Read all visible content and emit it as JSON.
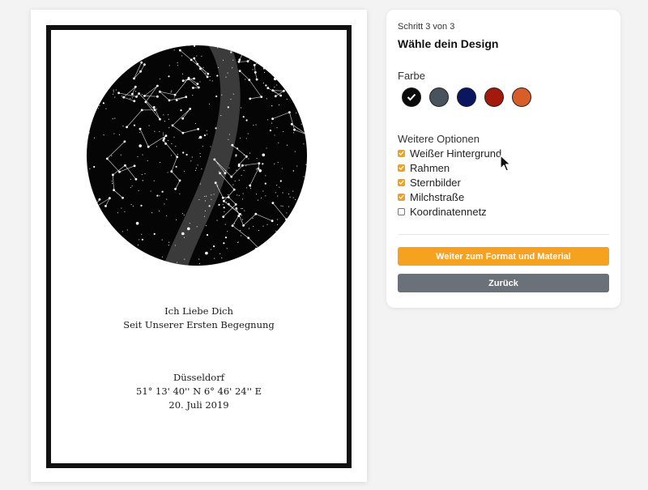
{
  "poster": {
    "message_line1": "Ich Liebe Dich",
    "message_line2": "Seit Unserer Ersten Begegnung",
    "location": "Düsseldorf",
    "coordinates": "51° 13' 40'' N 6° 46' 24'' E",
    "date": "20. Juli 2019"
  },
  "panel": {
    "step": "Schritt 3 von 3",
    "title": "Wähle dein Design",
    "color_label": "Farbe",
    "colors": [
      {
        "name": "black",
        "hex": "#0b0b0b",
        "selected": true
      },
      {
        "name": "slate",
        "hex": "#48535d",
        "selected": false
      },
      {
        "name": "navy",
        "hex": "#0b1660",
        "selected": false
      },
      {
        "name": "red",
        "hex": "#a31a0c",
        "selected": false
      },
      {
        "name": "orange",
        "hex": "#d95d2a",
        "selected": false
      }
    ],
    "options_label": "Weitere Optionen",
    "options": [
      {
        "label": "Weißer Hintergrund",
        "checked": true
      },
      {
        "label": "Rahmen",
        "checked": true
      },
      {
        "label": "Sternbilder",
        "checked": true
      },
      {
        "label": "Milchstraße",
        "checked": true
      },
      {
        "label": "Koordinatennetz",
        "checked": false
      }
    ],
    "next_button": "Weiter zum Format und Material",
    "back_button": "Zurück"
  },
  "icons": {
    "check": "check-icon",
    "cursor": "mouse-pointer-icon"
  },
  "accent_color": "#f5a21e"
}
